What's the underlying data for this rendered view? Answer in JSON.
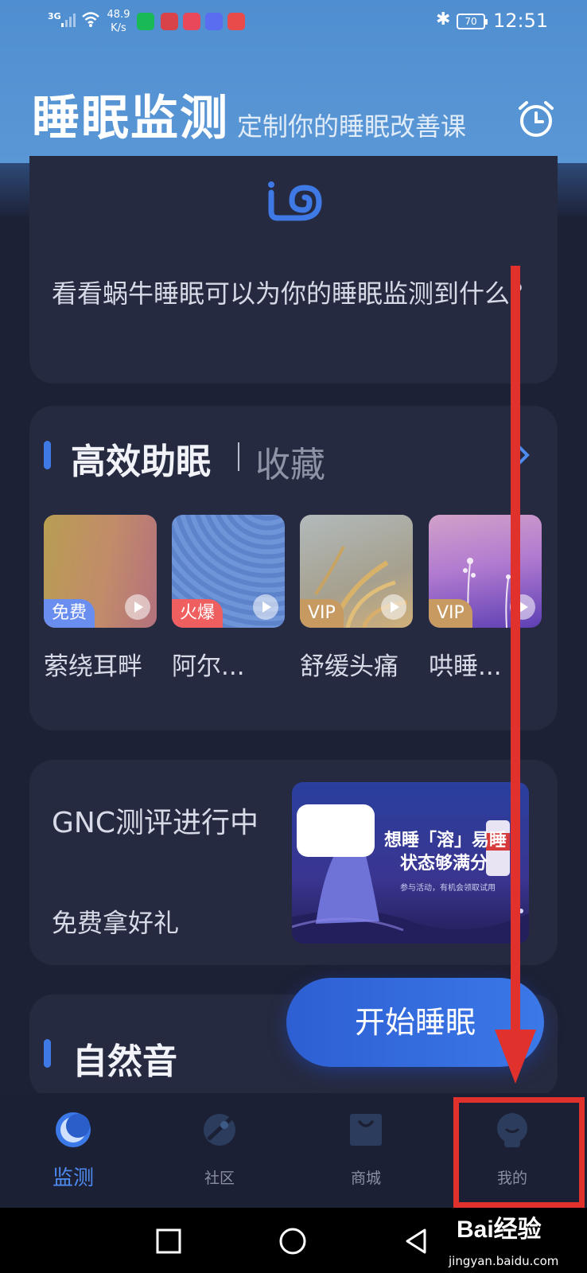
{
  "status_bar": {
    "network": "3G",
    "speed_value": "48.9",
    "speed_unit": "K/s",
    "battery": "70",
    "time": "12:51",
    "app_icon_colors": [
      "#19b955",
      "#d8434a",
      "#e8485a",
      "#5a6cf0",
      "#e94a4a"
    ]
  },
  "header": {
    "title": "睡眠监测",
    "subtitle": "定制你的睡眠改善课",
    "alarm_icon": "alarm-clock-icon"
  },
  "promo_card": {
    "logo_icon": "snail-logo-icon",
    "text": "看看蜗牛睡眠可以为你的睡眠监测到什么？"
  },
  "sleep_aid": {
    "title": "高效助眠",
    "alt_tab": "收藏",
    "items": [
      {
        "label": "萦绕耳畔",
        "badge": "免费"
      },
      {
        "label": "阿尔...",
        "badge": "火爆"
      },
      {
        "label": "舒缓头痛",
        "badge": "VIP"
      },
      {
        "label": "哄睡...",
        "badge": "VIP"
      }
    ]
  },
  "gnc_card": {
    "title": "GNC测评进行中",
    "subtitle": "免费拿好礼",
    "banner_line1": "想睡「溶」易睡",
    "banner_line2": "状态够满分",
    "banner_line3": "参与活动，有机会领取试用"
  },
  "nature_sounds": {
    "title": "自然音"
  },
  "start_button": "开始睡眠",
  "bottom_nav": [
    {
      "label": "监测",
      "icon": "moon-icon"
    },
    {
      "label": "社区",
      "icon": "community-icon"
    },
    {
      "label": "商城",
      "icon": "shop-bag-icon"
    },
    {
      "label": "我的",
      "icon": "profile-icon"
    }
  ],
  "watermark": {
    "brand": "Bai经验",
    "url": "jingyan.baidu.com"
  },
  "colors": {
    "accent": "#3f79e6",
    "background": "#1d2136",
    "card": "#262a40",
    "highlight": "#e0312d"
  }
}
